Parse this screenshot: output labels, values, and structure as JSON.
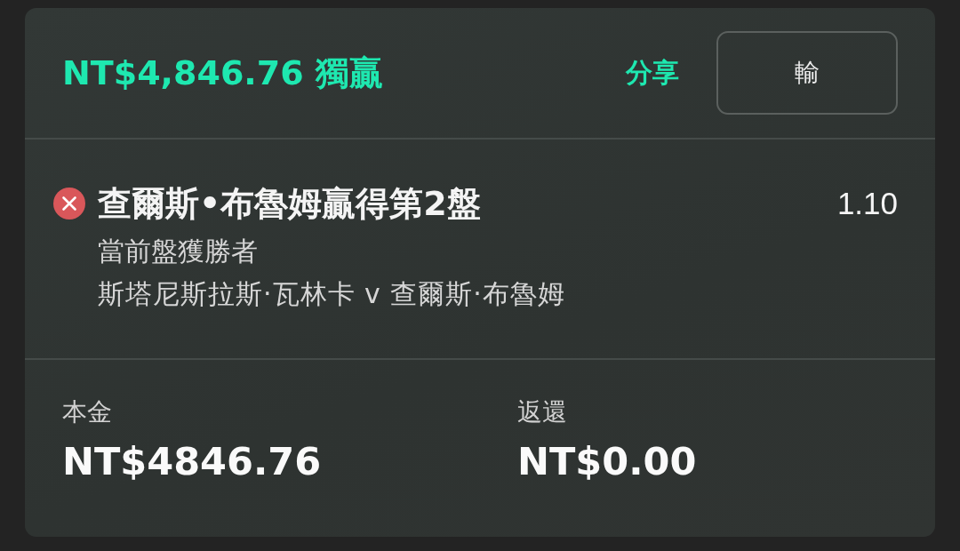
{
  "header": {
    "title": "NT$4,846.76 獨贏",
    "share": "分享",
    "result_button": "輸"
  },
  "selection": {
    "lost": true,
    "title": "查爾斯•布魯姆贏得第2盤",
    "odds": "1.10",
    "market": "當前盤獲勝者",
    "event": "斯塔尼斯拉斯·瓦林卡 v 查爾斯·布魯姆"
  },
  "summary": [
    {
      "label": "本金",
      "value": "NT$4846.76"
    },
    {
      "label": "返還",
      "value": "NT$0.00"
    }
  ]
}
